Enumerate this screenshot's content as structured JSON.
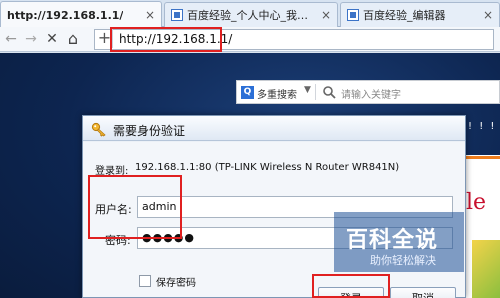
{
  "tabs": [
    {
      "title": "http://192.168.1.1/",
      "close": "×",
      "active": true
    },
    {
      "title": "百度经验_个人中心_我的经验",
      "close": "×",
      "active": false
    },
    {
      "title": "百度经验_编辑器",
      "close": "×",
      "active": false
    }
  ],
  "nav": {
    "back": "←",
    "forward": "→",
    "stop": "✕",
    "home": "⌂",
    "new_tab": "+",
    "url": "http://192.168.1.1/"
  },
  "search": {
    "logo": "Q",
    "engine": "多重搜索",
    "caret": "▼",
    "placeholder": "请输入关键字"
  },
  "page": {
    "exclaim": "! ! !",
    "brand_fragment": "le"
  },
  "dialog": {
    "title": "需要身份验证",
    "login_to_label": "登录到:",
    "login_to_value": "192.168.1.1:80 (TP-LINK Wireless N Router WR841N)",
    "username_label": "用户名:",
    "username_value": "admin",
    "password_label": "密码:",
    "password_value": "●●●●●",
    "remember_label": "保存密码",
    "login_button": "登录",
    "cancel_button": "取消"
  },
  "watermark": {
    "main": "百科全说",
    "sub": "助你轻松解决"
  },
  "colors": {
    "highlight": "#e02020",
    "accent": "#2b6fd6"
  }
}
